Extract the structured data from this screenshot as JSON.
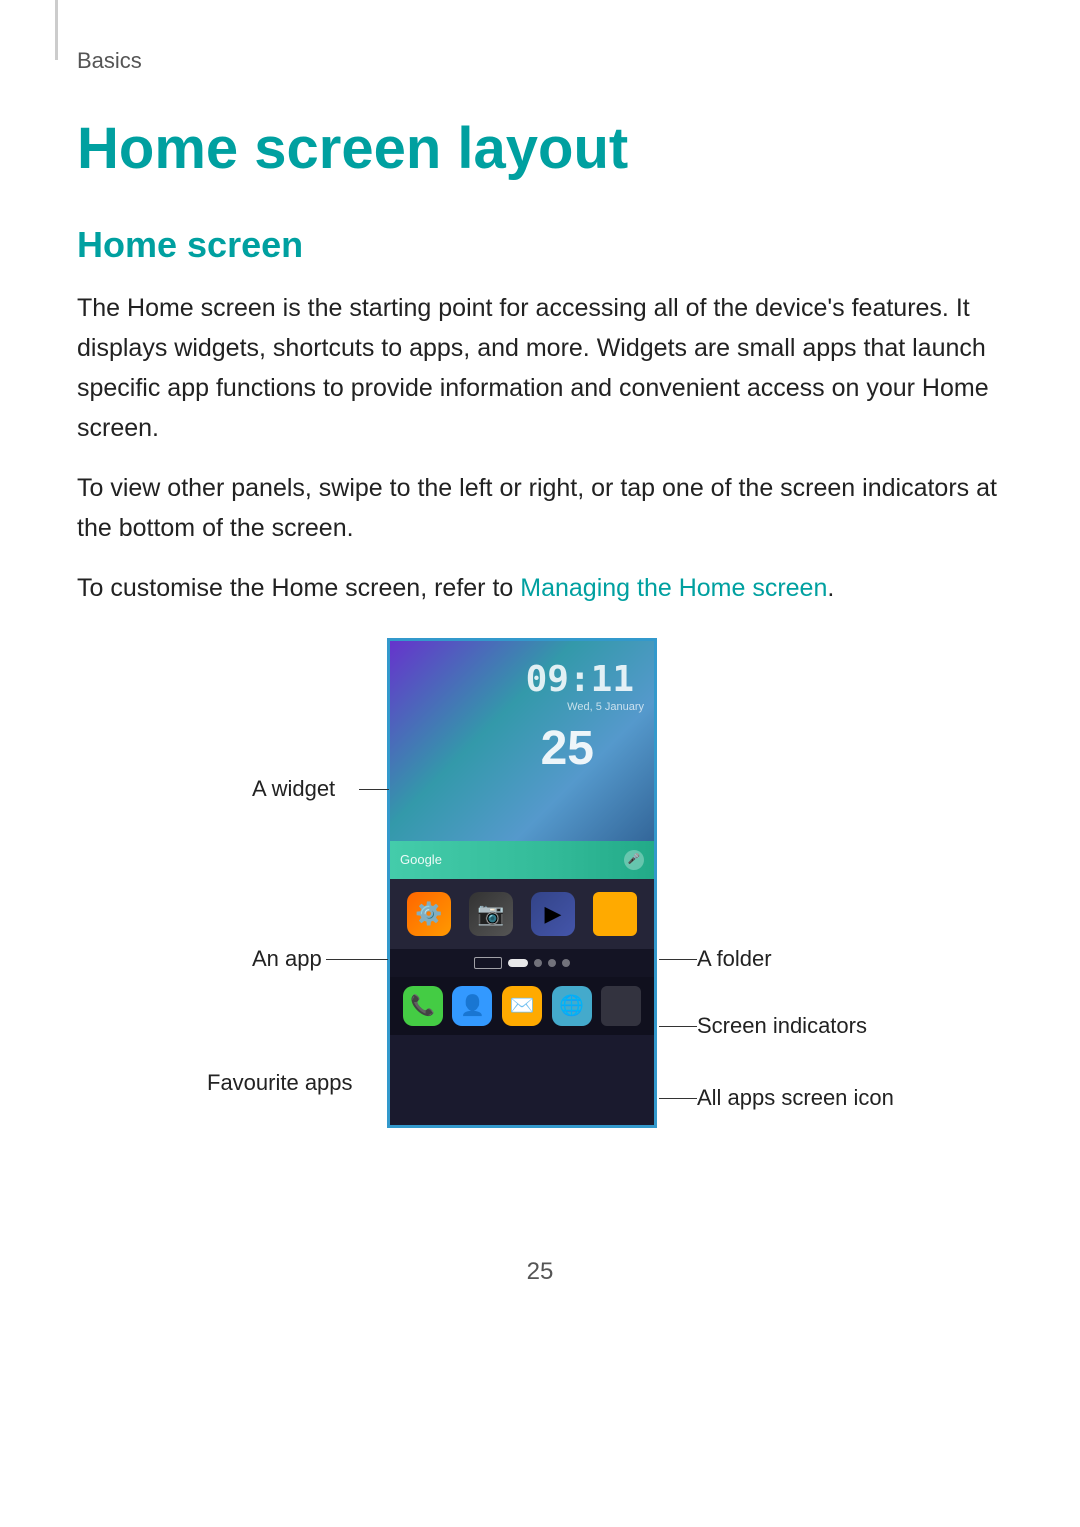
{
  "breadcrumb": "Basics",
  "page_title": "Home screen layout",
  "section_title": "Home screen",
  "paragraphs": [
    "The Home screen is the starting point for accessing all of the device's features. It displays widgets, shortcuts to apps, and more. Widgets are small apps that launch specific app functions to provide information and convenient access on your Home screen.",
    "To view other panels, swipe to the left or right, or tap one of the screen indicators at the bottom of the screen.",
    "To customise the Home screen, refer to"
  ],
  "link_text": "Managing the Home screen",
  "link_suffix": ".",
  "annotations": {
    "widget": "A widget",
    "app": "An app",
    "favourite_apps": "Favourite apps",
    "folder": "A folder",
    "screen_indicators": "Screen indicators",
    "all_apps": "All apps screen icon"
  },
  "widget_time": "09:11",
  "widget_date": "Wed, 5 January",
  "widget_number": "25",
  "page_number": "25",
  "colors": {
    "accent": "#00a0a0",
    "link": "#00a0a0",
    "text": "#222222",
    "muted": "#555555"
  }
}
